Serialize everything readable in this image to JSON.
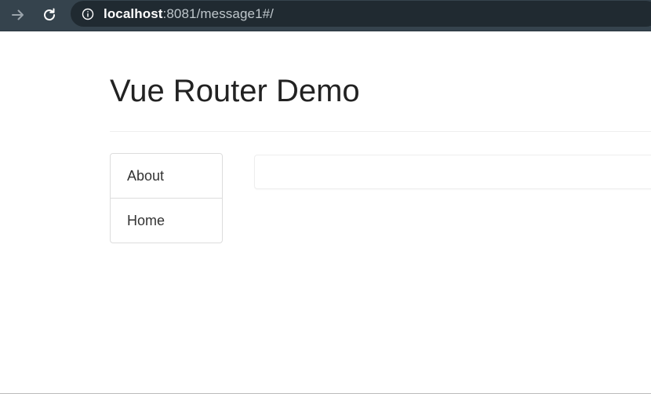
{
  "browser": {
    "url_host": "localhost",
    "url_rest": ":8081/message1#/",
    "forward_icon": "arrow-right-icon",
    "reload_icon": "reload-icon",
    "info_icon": "info-icon",
    "toolbar_color": "#35434d",
    "omnibox_color": "#202a31"
  },
  "page": {
    "title": "Vue Router Demo"
  },
  "nav": {
    "items": [
      {
        "label": "About"
      },
      {
        "label": "Home"
      }
    ]
  },
  "content": {
    "text": ""
  }
}
